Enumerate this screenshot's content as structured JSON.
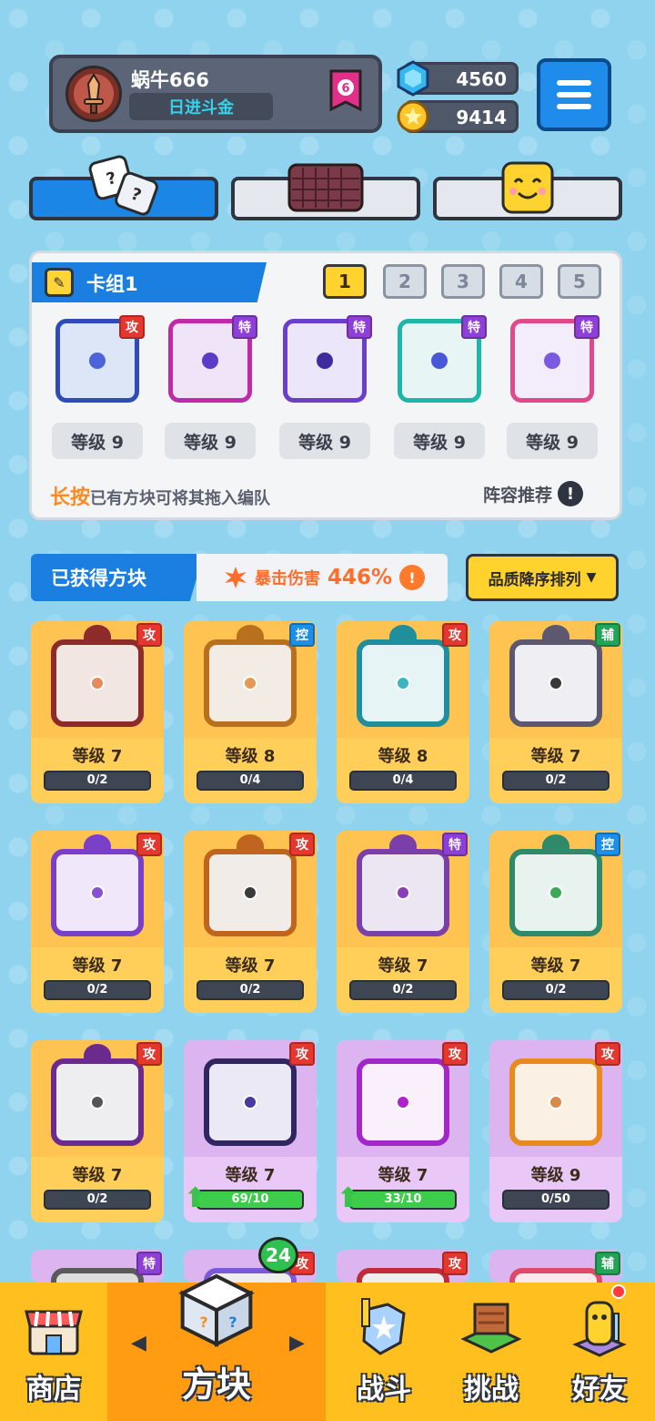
{
  "header": {
    "player_name": "蜗牛666",
    "rank_title": "日进斗金",
    "rank_badge_value": "6",
    "gems": "4560",
    "coins": "9414"
  },
  "deck": {
    "title": "卡组1",
    "slots": [
      "1",
      "2",
      "3",
      "4",
      "5"
    ],
    "active_slot": "1",
    "cards": [
      {
        "tag": "攻",
        "level": "等级 9",
        "tag_type": "atk",
        "border": "#2f4bb8",
        "bg": "#dde6f7",
        "dot": "#4d63d8"
      },
      {
        "tag": "特",
        "level": "等级 9",
        "tag_type": "spc",
        "border": "#c02aa8",
        "bg": "#efe4f8",
        "dot": "#5a3cc8"
      },
      {
        "tag": "特",
        "level": "等级 9",
        "tag_type": "spc",
        "border": "#6b3fc8",
        "bg": "#ece6fa",
        "dot": "#3f2a9e"
      },
      {
        "tag": "特",
        "level": "等级 9",
        "tag_type": "spc",
        "border": "#1fb5a8",
        "bg": "#e7f6f5",
        "dot": "#4856d8"
      },
      {
        "tag": "特",
        "level": "等级 9",
        "tag_type": "spc",
        "border": "#e04a8a",
        "bg": "#f3ecfb",
        "dot": "#7a5ae0"
      }
    ],
    "hint_highlight": "长按",
    "hint_text": "已有方块可将其拖入编队",
    "lineup_label": "阵容推荐",
    "info_glyph": "!"
  },
  "collection": {
    "title": "已获得方块",
    "crit_label": "暴击伤害",
    "crit_value": "446%",
    "sort_label": "品质降序排列",
    "blocks": [
      {
        "tag": "攻",
        "tag_type": "atk",
        "level": "等级 7",
        "progress": "0/2",
        "fill": 0,
        "style": "gold",
        "frame": "#8e2a2a",
        "dot": "#e58a5a",
        "inner": "#f1e6e1"
      },
      {
        "tag": "控",
        "tag_type": "ctl",
        "level": "等级 8",
        "progress": "0/4",
        "fill": 0,
        "style": "gold",
        "frame": "#b8701f",
        "dot": "#e39a55",
        "inner": "#f3ece4"
      },
      {
        "tag": "攻",
        "tag_type": "atk",
        "level": "等级 8",
        "progress": "0/4",
        "fill": 0,
        "style": "gold",
        "frame": "#1f8f9e",
        "dot": "#3cb4c2",
        "inner": "#e6f4f6"
      },
      {
        "tag": "辅",
        "tag_type": "sup",
        "level": "等级 7",
        "progress": "0/2",
        "fill": 0,
        "style": "gold",
        "frame": "#5b5870",
        "dot": "#3a3a3a",
        "inner": "#efeef3"
      },
      {
        "tag": "攻",
        "tag_type": "atk",
        "level": "等级 7",
        "progress": "0/2",
        "fill": 0,
        "style": "gold",
        "frame": "#7a3fc8",
        "dot": "#8a4fd2",
        "inner": "#f0e8fa"
      },
      {
        "tag": "攻",
        "tag_type": "atk",
        "level": "等级 7",
        "progress": "0/2",
        "fill": 0,
        "style": "gold",
        "frame": "#c0651f",
        "dot": "#3a3a3a",
        "inner": "#f1ece7"
      },
      {
        "tag": "特",
        "tag_type": "spc",
        "level": "等级 7",
        "progress": "0/2",
        "fill": 0,
        "style": "gold",
        "frame": "#7a3fa8",
        "dot": "#8a3fb8",
        "inner": "#ece6f2"
      },
      {
        "tag": "控",
        "tag_type": "ctl",
        "level": "等级 7",
        "progress": "0/2",
        "fill": 0,
        "style": "gold",
        "frame": "#2f8a6a",
        "dot": "#3caa55",
        "inner": "#e8f2ef"
      },
      {
        "tag": "攻",
        "tag_type": "atk",
        "level": "等级 7",
        "progress": "0/2",
        "fill": 0,
        "style": "gold",
        "frame": "#6a2a8e",
        "dot": "#555",
        "inner": "#eeeef0"
      },
      {
        "tag": "攻",
        "tag_type": "atk",
        "level": "等级 7",
        "progress": "69/10",
        "fill": 1,
        "style": "purple",
        "frame": "#2f2660",
        "dot": "#4a3aa0",
        "inner": "#ece9f6",
        "upgradable": true
      },
      {
        "tag": "攻",
        "tag_type": "atk",
        "level": "等级 7",
        "progress": "33/10",
        "fill": 1,
        "style": "purple",
        "frame": "#a326c8",
        "dot": "#b023c8",
        "inner": "#faf0fc",
        "upgradable": true
      },
      {
        "tag": "攻",
        "tag_type": "atk",
        "level": "等级 9",
        "progress": "0/50",
        "fill": 0,
        "style": "purple",
        "frame": "#e88a1f",
        "dot": "#d98a4a",
        "inner": "#fbf0e4"
      },
      {
        "tag": "特",
        "tag_type": "spc",
        "level": "",
        "progress": "",
        "fill": 0,
        "style": "purple",
        "frame": "#5a5a5a",
        "dot": "#5a5a5a",
        "inner": "#ddd",
        "partial": true
      },
      {
        "tag": "攻",
        "tag_type": "atk",
        "level": "",
        "progress": "",
        "fill": 0,
        "style": "purple",
        "frame": "#7a5ad8",
        "dot": "#5a5a5a",
        "inner": "#eee",
        "partial": true
      },
      {
        "tag": "攻",
        "tag_type": "atk",
        "level": "",
        "progress": "",
        "fill": 0,
        "style": "purple",
        "frame": "#c02a3a",
        "dot": "#5a5a5a",
        "inner": "#eee",
        "partial": true
      },
      {
        "tag": "辅",
        "tag_type": "sup",
        "level": "",
        "progress": "",
        "fill": 0,
        "style": "purple",
        "frame": "#e04a6a",
        "dot": "#5a5a5a",
        "inner": "#fbe8ee",
        "partial": true
      }
    ]
  },
  "nav": {
    "shop": "商店",
    "blocks": "方块",
    "battle": "战斗",
    "challenge": "挑战",
    "friends": "好友",
    "blocks_badge": "24",
    "prev_arrow": "◀",
    "next_arrow": "▶"
  }
}
